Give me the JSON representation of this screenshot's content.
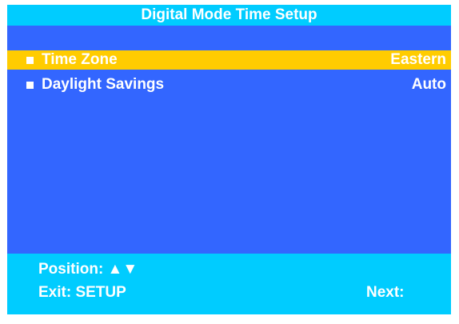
{
  "screen": {
    "title": "Digital Mode Time Setup"
  },
  "menu": {
    "items": [
      {
        "label": "Time Zone",
        "value": "Eastern",
        "selected": true
      },
      {
        "label": "Daylight Savings",
        "value": "Auto",
        "selected": false
      }
    ],
    "bullet_icon": "square-bullet-icon"
  },
  "footer": {
    "position_label": "Position: ▲▼",
    "exit_label": "Exit: SETUP",
    "next_label": "Next:"
  },
  "colors": {
    "background": "#3366ff",
    "title_bar": "#00ccff",
    "footer_bar": "#00ccff",
    "highlight": "#ffcc00",
    "text": "#ffffff"
  }
}
